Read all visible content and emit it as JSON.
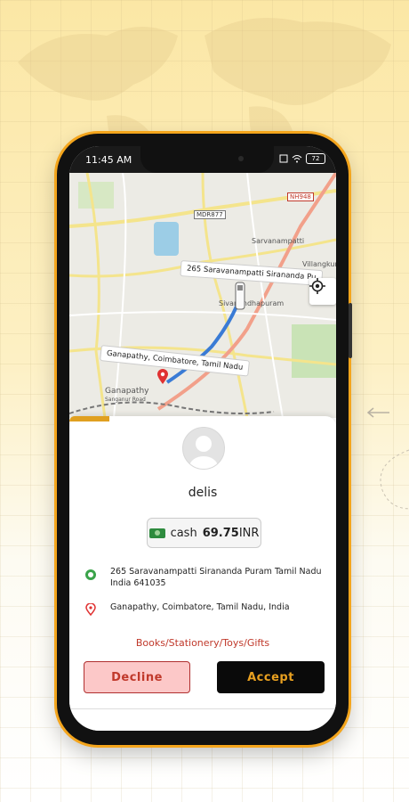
{
  "status_bar": {
    "time": "11:45 AM",
    "battery": "72"
  },
  "map": {
    "labels": {
      "sarvanampatti": "Sarvanampatti",
      "villangkuri": "Villangkuri",
      "sivanandhapuram": "Sivanandhapuram",
      "ganapathy": "Ganapathy",
      "sanganur": "Sanganur Road"
    },
    "badges": {
      "nh": "NH948",
      "mdr": "MDR877"
    },
    "callout_pickup": "265  Saravanampatti Sirananda Pu",
    "callout_drop": "Ganapathy, Coimbatore, Tamil Nadu",
    "route_color": "#3a7bd5"
  },
  "order": {
    "customer_name": "delis",
    "payment_method": "cash",
    "amount": "69.75",
    "currency": "INR",
    "pickup_address": "265  Saravanampatti Sirananda Puram Tamil Nadu India 641035",
    "drop_address": "Ganapathy, Coimbatore, Tamil Nadu, India",
    "category": "Books/Stationery/Toys/Gifts"
  },
  "actions": {
    "decline_label": "Decline",
    "accept_label": "Accept"
  },
  "colors": {
    "accent": "#f4a51c",
    "pickup": "#3aa34a",
    "drop": "#e03131",
    "decline_text": "#c0392b"
  }
}
